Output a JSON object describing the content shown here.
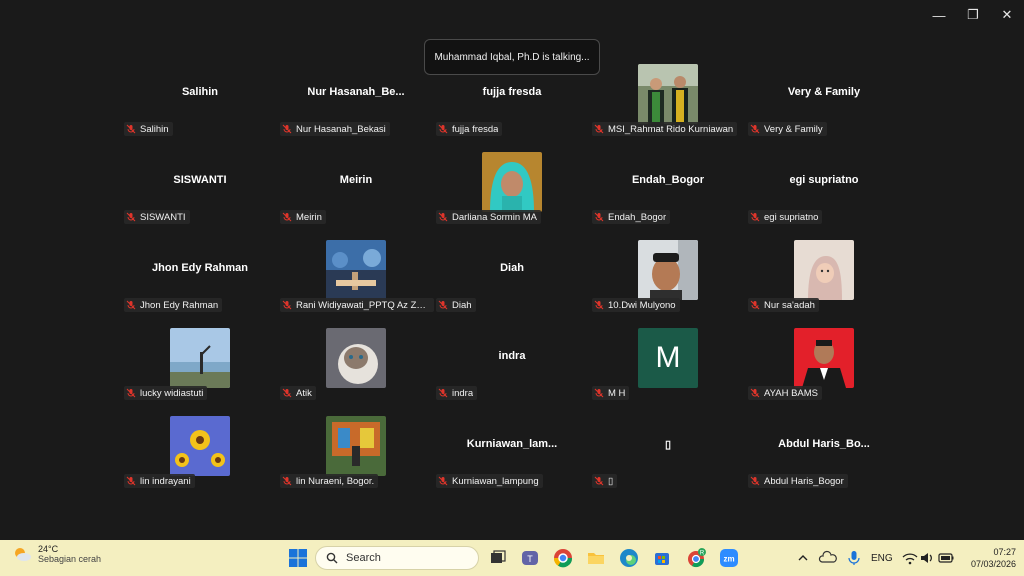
{
  "window": {
    "minimize_glyph": "—",
    "restore_glyph": "❐",
    "close_glyph": "✕"
  },
  "talking_banner": "Muhammad Iqbal, Ph.D is talking...",
  "participants": [
    {
      "center_name": "Salihin",
      "label": "Salihin"
    },
    {
      "center_name": "Nur  Hasanah_Be...",
      "label": "Nur Hasanah_Bekasi"
    },
    {
      "center_name": "fujja fresda",
      "label": "fujja fresda"
    },
    {
      "center_name": "",
      "label": "MSI_Rahmat Rido Kurniawan",
      "photo": "graduation-photo"
    },
    {
      "center_name": "Very & Family",
      "label": "Very & Family"
    },
    {
      "center_name": "SISWANTI",
      "label": "SISWANTI"
    },
    {
      "center_name": "Meirin",
      "label": "Meirin"
    },
    {
      "center_name": "",
      "label": "Darliana Sormin MA",
      "photo": "hijab-woman-photo"
    },
    {
      "center_name": "Endah_Bogor",
      "label": "Endah_Bogor"
    },
    {
      "center_name": "egi supriatno",
      "label": "egi supriatno"
    },
    {
      "center_name": "Jhon Edy Rahman",
      "label": "Jhon Edy Rahman"
    },
    {
      "center_name": "",
      "label": "Rani Widiyawati_PPTQ Az Zah...",
      "photo": "outdoor-group-photo"
    },
    {
      "center_name": "Diah",
      "label": "Diah"
    },
    {
      "center_name": "",
      "label": "10.Dwi Mulyono",
      "photo": "man-cap-photo"
    },
    {
      "center_name": "",
      "label": "Nur sa'adah",
      "photo": "baby-photo"
    },
    {
      "center_name": "",
      "label": "lucky widiastuti",
      "photo": "beach-photo"
    },
    {
      "center_name": "",
      "label": "Atik",
      "photo": "cat-photo"
    },
    {
      "center_name": "indra",
      "label": "indra"
    },
    {
      "center_name": "",
      "label": "M H",
      "photo": "letter-avatar",
      "letter": "M"
    },
    {
      "center_name": "",
      "label": "AYAH BAMS",
      "photo": "red-portrait-photo"
    },
    {
      "center_name": "",
      "label": "lin indrayani",
      "photo": "sunflower-photo"
    },
    {
      "center_name": "",
      "label": "lin Nuraeni, Bogor.",
      "photo": "playground-photo"
    },
    {
      "center_name": "Kurniawan_lam...",
      "label": "Kurniawan_lampung"
    },
    {
      "center_name": "▯",
      "label": "▯"
    },
    {
      "center_name": "Abdul  Haris_Bo...",
      "label": "Abdul Haris_Bogor"
    }
  ],
  "taskbar": {
    "weather_temp": "24°C",
    "weather_desc": "Sebagian cerah",
    "search_placeholder": "Search",
    "lang": "ENG",
    "time": "07:27",
    "date": "07/03/2026",
    "chrome_badge": "R",
    "zoom_label": "zm"
  },
  "colors": {
    "background": "#1a1a1a",
    "taskbar": "#f4efc0",
    "mute_red": "#e0352b",
    "avatar_green": "#1b5a48"
  }
}
